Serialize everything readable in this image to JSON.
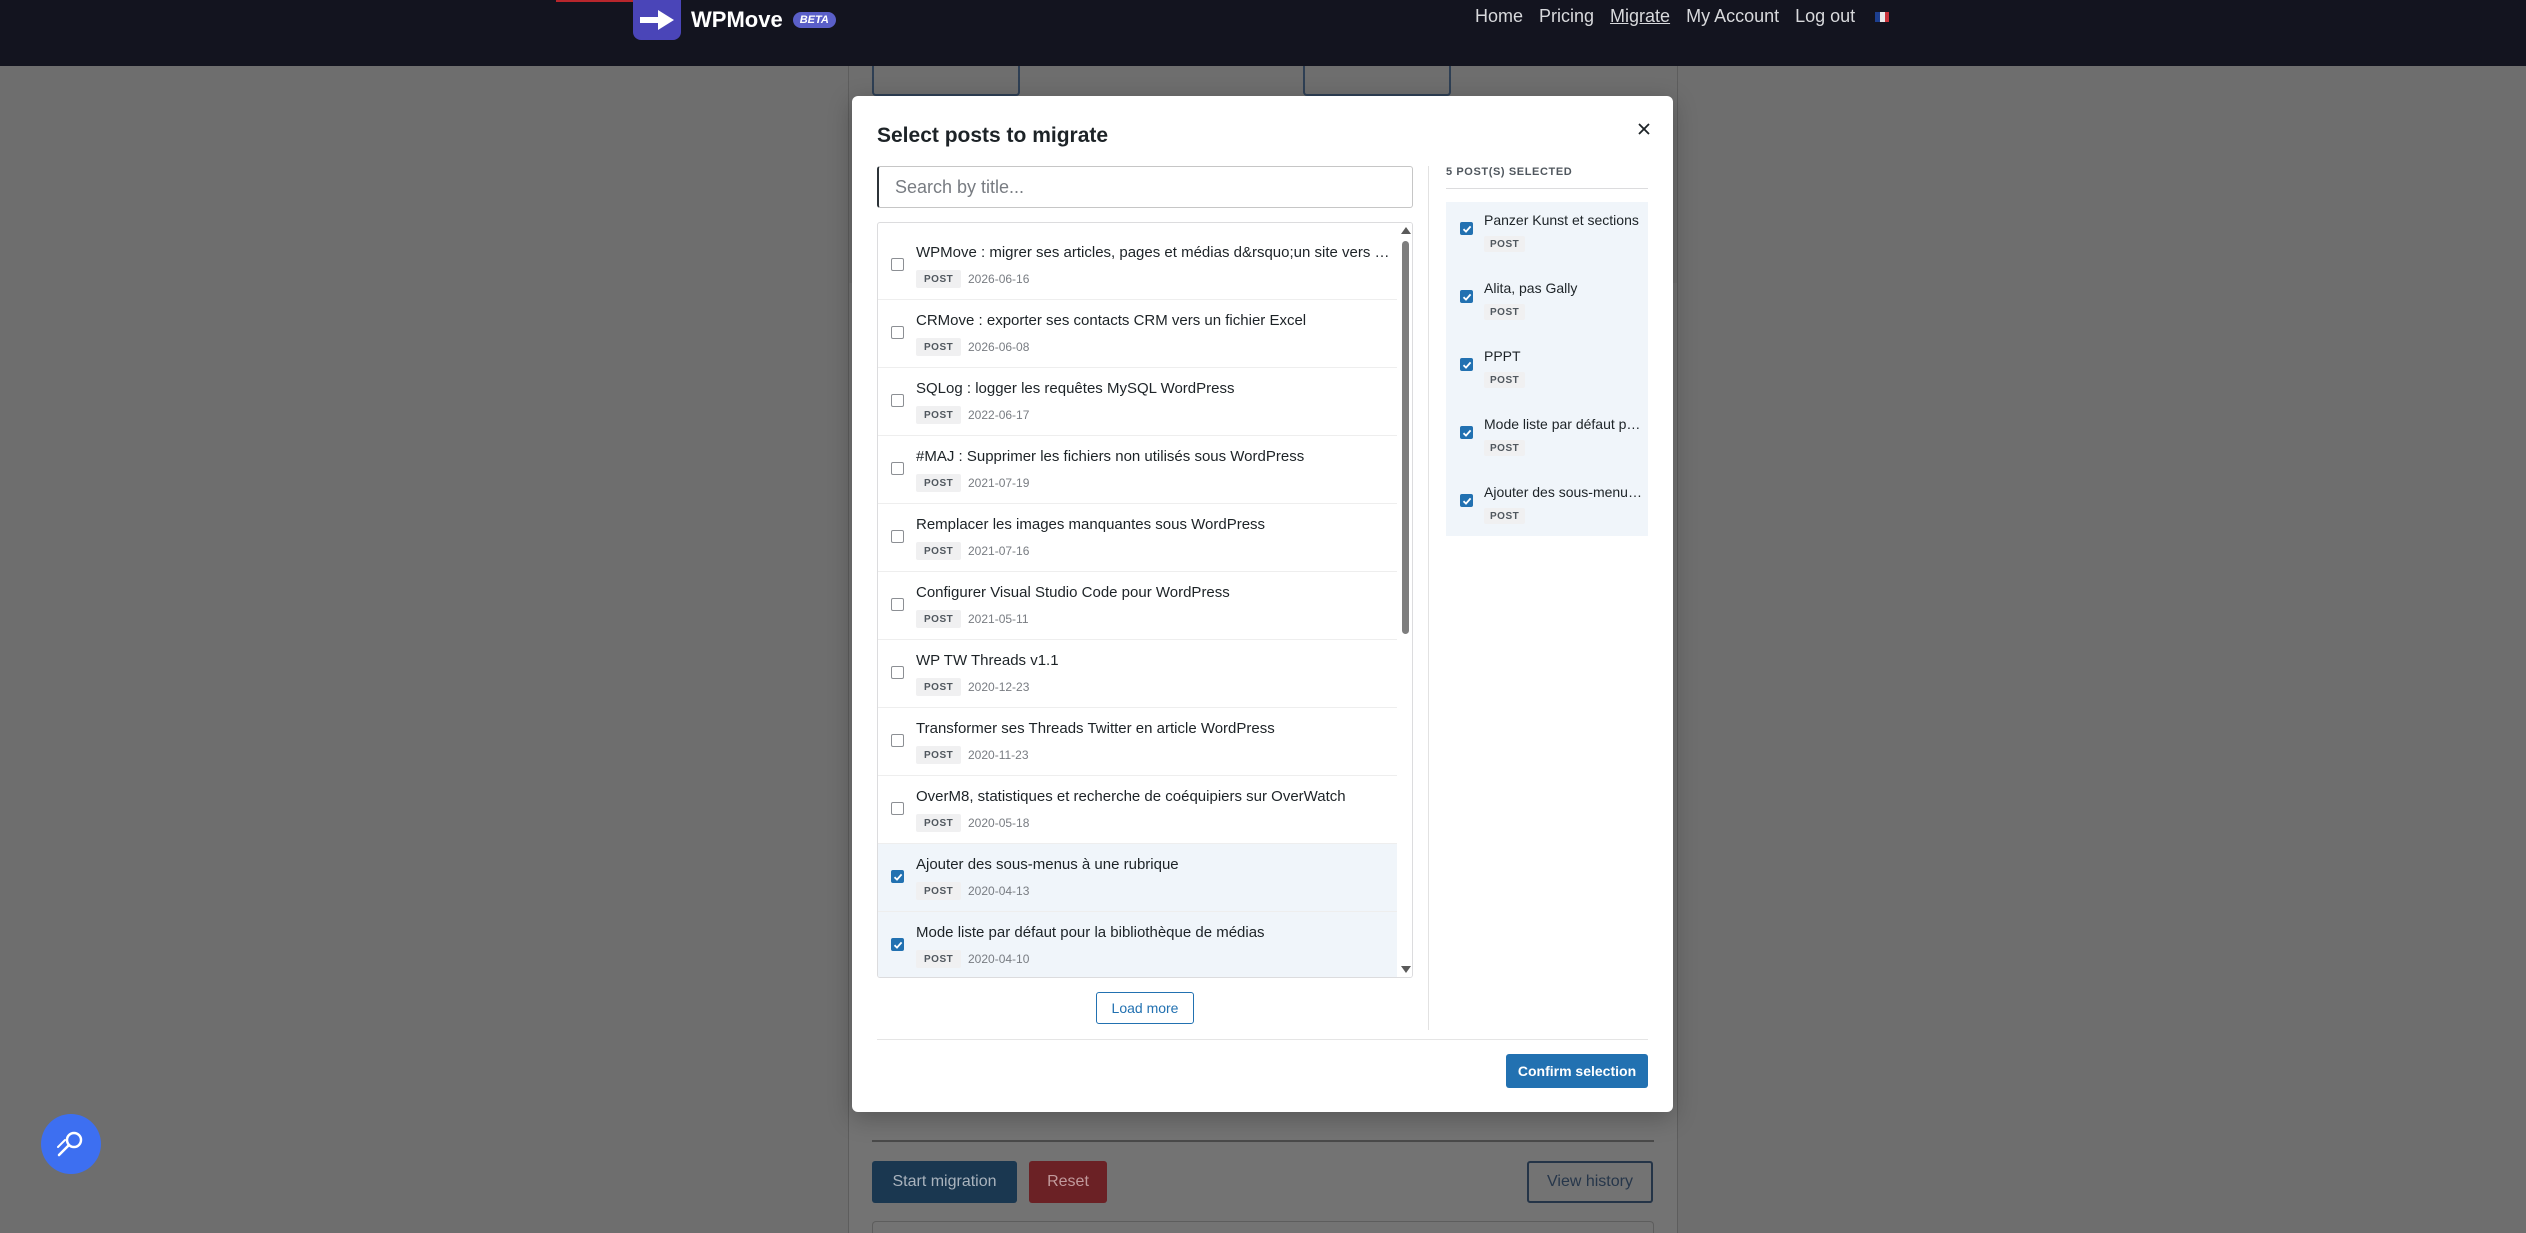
{
  "navbar": {
    "brand": "WPMove",
    "badge": "BETA",
    "links": [
      "Home",
      "Pricing",
      "Migrate",
      "My Account",
      "Log out"
    ],
    "active_link": "Migrate"
  },
  "background": {
    "start_migration": "Start migration",
    "reset": "Reset",
    "view_history": "View history"
  },
  "modal": {
    "title": "Select posts to migrate",
    "search_placeholder": "Search by title...",
    "load_more": "Load more",
    "selected_header": "5 POST(S) SELECTED",
    "confirm": "Confirm selection",
    "posts": [
      {
        "title": "WPMove : migrer ses articles, pages et médias d&rsquo;un site vers un autre",
        "type": "POST",
        "date": "2026-06-16",
        "checked": false
      },
      {
        "title": "CRMove : exporter ses contacts CRM vers un fichier Excel",
        "type": "POST",
        "date": "2026-06-08",
        "checked": false
      },
      {
        "title": "SQLog : logger les requêtes MySQL WordPress",
        "type": "POST",
        "date": "2022-06-17",
        "checked": false
      },
      {
        "title": "#MAJ : Supprimer les fichiers non utilisés sous WordPress",
        "type": "POST",
        "date": "2021-07-19",
        "checked": false
      },
      {
        "title": "Remplacer les images manquantes sous WordPress",
        "type": "POST",
        "date": "2021-07-16",
        "checked": false
      },
      {
        "title": "Configurer Visual Studio Code pour WordPress",
        "type": "POST",
        "date": "2021-05-11",
        "checked": false
      },
      {
        "title": "WP TW Threads v1.1",
        "type": "POST",
        "date": "2020-12-23",
        "checked": false
      },
      {
        "title": "Transformer ses Threads Twitter en article WordPress",
        "type": "POST",
        "date": "2020-11-23",
        "checked": false
      },
      {
        "title": "OverM8, statistiques et recherche de coéquipiers sur OverWatch",
        "type": "POST",
        "date": "2020-05-18",
        "checked": false
      },
      {
        "title": "Ajouter des sous-menus à une rubrique",
        "type": "POST",
        "date": "2020-04-13",
        "checked": true
      },
      {
        "title": "Mode liste par défaut pour la bibliothèque de médias",
        "type": "POST",
        "date": "2020-04-10",
        "checked": true
      }
    ],
    "selected": [
      {
        "title": "Panzer Kunst et sections",
        "type": "POST"
      },
      {
        "title": "Alita, pas Gally",
        "type": "POST"
      },
      {
        "title": "PPPT",
        "type": "POST"
      },
      {
        "title": "Mode liste par défaut pour la bibliothèque de médias",
        "type": "POST"
      },
      {
        "title": "Ajouter des sous-menus à une rubrique",
        "type": "POST"
      }
    ]
  },
  "colors": {
    "primary": "#2271b1",
    "navbar": "#13141f",
    "brand_logo": "#4a45b8",
    "fab": "#3d6ff1",
    "selected_bg": "#f0f5fa"
  },
  "icons": {
    "close": "close-icon",
    "logo": "arrow-right-icon",
    "fab": "magnifier-icon",
    "flag": "flag-fr-icon"
  }
}
